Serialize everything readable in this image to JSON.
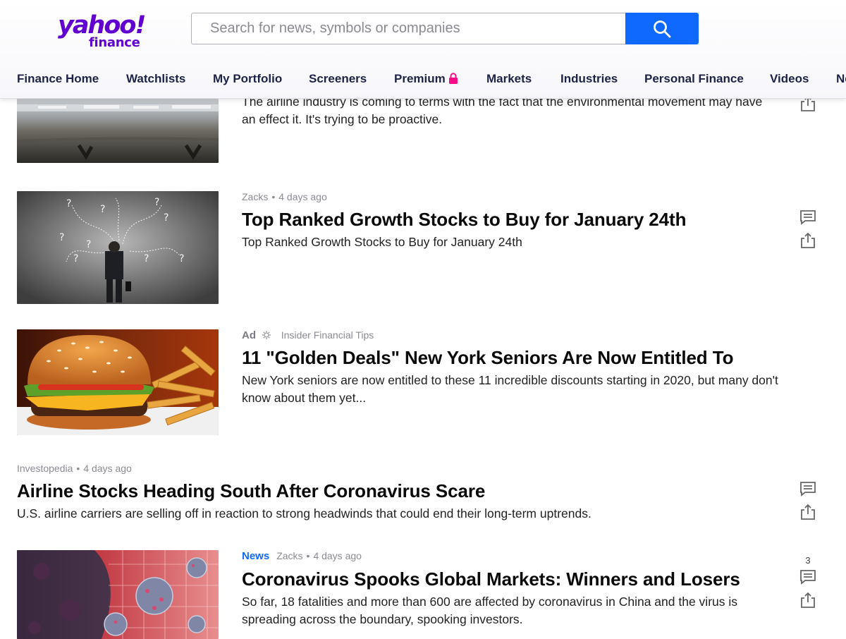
{
  "brand": {
    "logo_word": "yahoo!",
    "logo_sub": "finance",
    "color": "#6001d2"
  },
  "search": {
    "placeholder": "Search for news, symbols or companies",
    "button_icon": "search-icon",
    "button_color": "#0f69ff"
  },
  "nav": {
    "items": [
      {
        "label": "Finance Home"
      },
      {
        "label": "Watchlists"
      },
      {
        "label": "My Portfolio"
      },
      {
        "label": "Screeners"
      },
      {
        "label": "Premium",
        "icon": "lock-icon",
        "icon_color": "#ff0a8a"
      },
      {
        "label": "Markets"
      },
      {
        "label": "Industries"
      },
      {
        "label": "Personal Finance"
      },
      {
        "label": "Videos"
      },
      {
        "label": "Ne"
      }
    ]
  },
  "feed": {
    "items": [
      {
        "summary": "The airline industry is coming to terms with the fact that the environmental movement may have an effect it. It's trying to be proactive.",
        "actions": [
          "share-icon"
        ]
      },
      {
        "source": "Zacks",
        "age": "4 days ago",
        "title": "Top Ranked Growth Stocks to Buy for January 24th",
        "summary": "Top Ranked Growth Stocks to Buy for January 24th",
        "actions": [
          "comment-icon",
          "share-icon"
        ]
      },
      {
        "ad_label": "Ad",
        "source": "Insider Financial Tips",
        "title": "11 \"Golden Deals\" New York Seniors Are Now Entitled To",
        "summary": "New York seniors are now entitled to these 11 incredible discounts starting in 2020, but many don't know about them yet..."
      },
      {
        "source": "Investopedia",
        "age": "4 days ago",
        "title": "Airline Stocks Heading South After Coronavirus Scare",
        "summary": "U.S. airline carriers are selling off in reaction to strong headwinds that could end their long-term uptrends.",
        "actions": [
          "comment-icon",
          "share-icon"
        ]
      },
      {
        "tag": "News",
        "source": "Zacks",
        "age": "4 days ago",
        "title": "Coronavirus Spooks Global Markets: Winners and Losers",
        "summary": "So far, 18 fatalities and more than 600 are affected by coronavirus in China and the virus is spreading across the boundary, spooking investors.",
        "comment_count": "3",
        "actions": [
          "comment-icon",
          "share-icon"
        ]
      }
    ]
  }
}
